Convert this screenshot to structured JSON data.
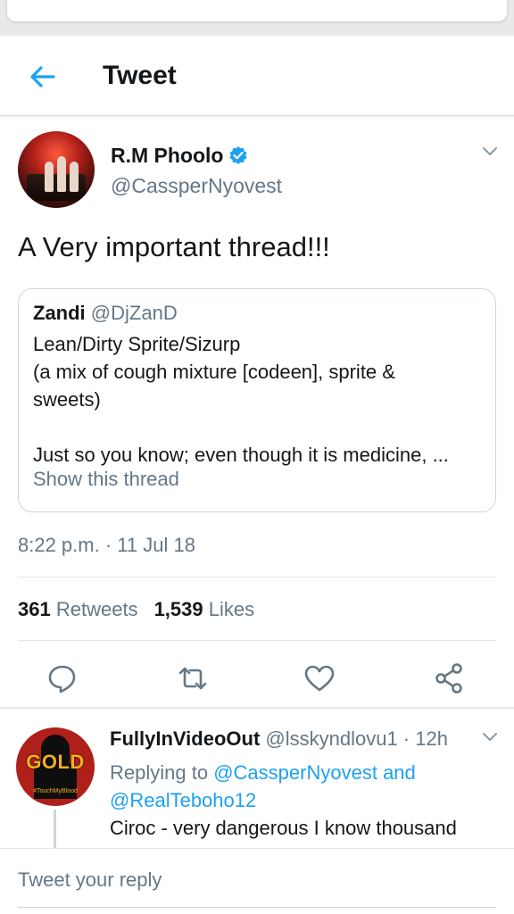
{
  "header": {
    "title": "Tweet"
  },
  "tweet": {
    "author_name": "R.M Phoolo",
    "author_handle": "@CassperNyovest",
    "text": "A Very important thread!!!",
    "quoted": {
      "name": "Zandi",
      "handle": "@DjZanD",
      "lines": [
        "Lean/Dirty Sprite/Sizurp",
        "(a mix of cough mixture [codeen], sprite &",
        "sweets)",
        "",
        "Just so you know; even though it is medicine, ..."
      ],
      "show_thread": "Show this thread"
    },
    "timestamp": "8:22 p.m. · 11 Jul 18",
    "retweets_count": "361",
    "retweets_label": "Retweets",
    "likes_count": "1,539",
    "likes_label": "Likes"
  },
  "reply": {
    "name": "FullyInVideoOut",
    "handle": "@lsskyndlovu1",
    "time": "12h",
    "replying_prefix": "Replying to",
    "replying_to_1": "@CassperNyovest",
    "replying_and": "and",
    "replying_to_2": "@RealTeboho12",
    "text": "Ciroc - very dangerous I know thousand",
    "avatar_text": "GOLD",
    "avatar_tag": "#TouchMyBlood"
  },
  "composer": {
    "placeholder": "Tweet your reply"
  },
  "colors": {
    "accent": "#1da1f2",
    "muted": "#657786",
    "text": "#14171a",
    "verified": "#1da1f2"
  },
  "icons": [
    "back-arrow-icon",
    "verified-badge-icon",
    "chevron-down-icon",
    "reply-icon",
    "retweet-icon",
    "like-heart-icon",
    "share-icon"
  ]
}
